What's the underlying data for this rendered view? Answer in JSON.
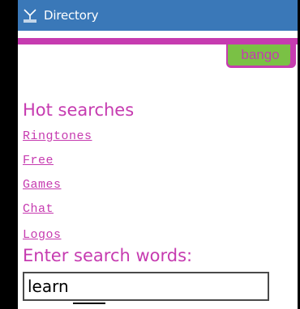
{
  "window": {
    "title": "Directory",
    "icon": "antenna-icon"
  },
  "branding": {
    "logo_text": "bango",
    "accent_color": "#c63bb0",
    "logo_color": "#7ac145",
    "titlebar_color": "#3a78b8"
  },
  "hot_searches": {
    "heading": "Hot searches",
    "links": [
      {
        "label": "Ringtones"
      },
      {
        "label": "Free"
      },
      {
        "label": "Games"
      },
      {
        "label": "Chat"
      },
      {
        "label": "Logos"
      }
    ]
  },
  "search": {
    "prompt": "Enter search words:",
    "value": "learn"
  }
}
